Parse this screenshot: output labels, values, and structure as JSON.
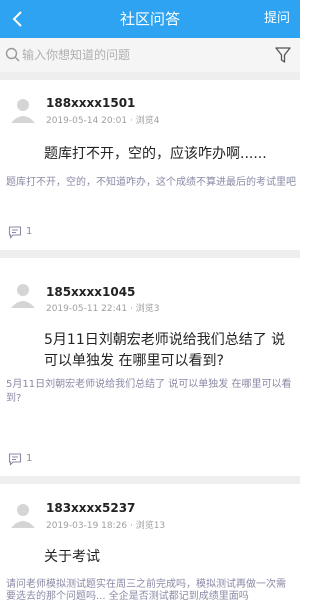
{
  "header": {
    "title": "社区问答",
    "ask_label": "提问"
  },
  "search": {
    "placeholder": "输入你想知道的问题"
  },
  "posts": [
    {
      "user": "188xxxx1501",
      "date": "2019-05-14 20:01",
      "views": "浏览4",
      "title": "题库打不开，空的，应该咋办啊......",
      "body": "题库打不开，空的，不知道咋办，这个成绩不算进最后的考试里吧",
      "comments": "1"
    },
    {
      "user": "185xxxx1045",
      "date": "2019-05-11 22:41",
      "views": "浏览3",
      "title": "5月11日刘朝宏老师说给我们总结了 说可以单独发 在哪里可以看到?",
      "body": "5月11日刘朝宏老师说给我们总结了 说可以单独发 在哪里可以看到?",
      "comments": "1"
    },
    {
      "user": "183xxxx5237",
      "date": "2019-03-19 18:26",
      "views": "浏览13",
      "title": "关于考试",
      "body": "请问老师模拟测试题实在周三之前完成吗，模拟测试再做一次需",
      "body2": "要选去的那个问题吗... 全企是否测试都记到成绩里面吗",
      "comments": ""
    }
  ],
  "icons": {
    "back": "chevron-left-icon",
    "search": "search-icon",
    "filter": "filter-icon",
    "comment": "comment-icon",
    "avatar": "user-avatar-icon"
  },
  "colors": {
    "header": "#2ea3f2",
    "meta": "#a0a0a0",
    "body_text": "#8a8aa6"
  }
}
